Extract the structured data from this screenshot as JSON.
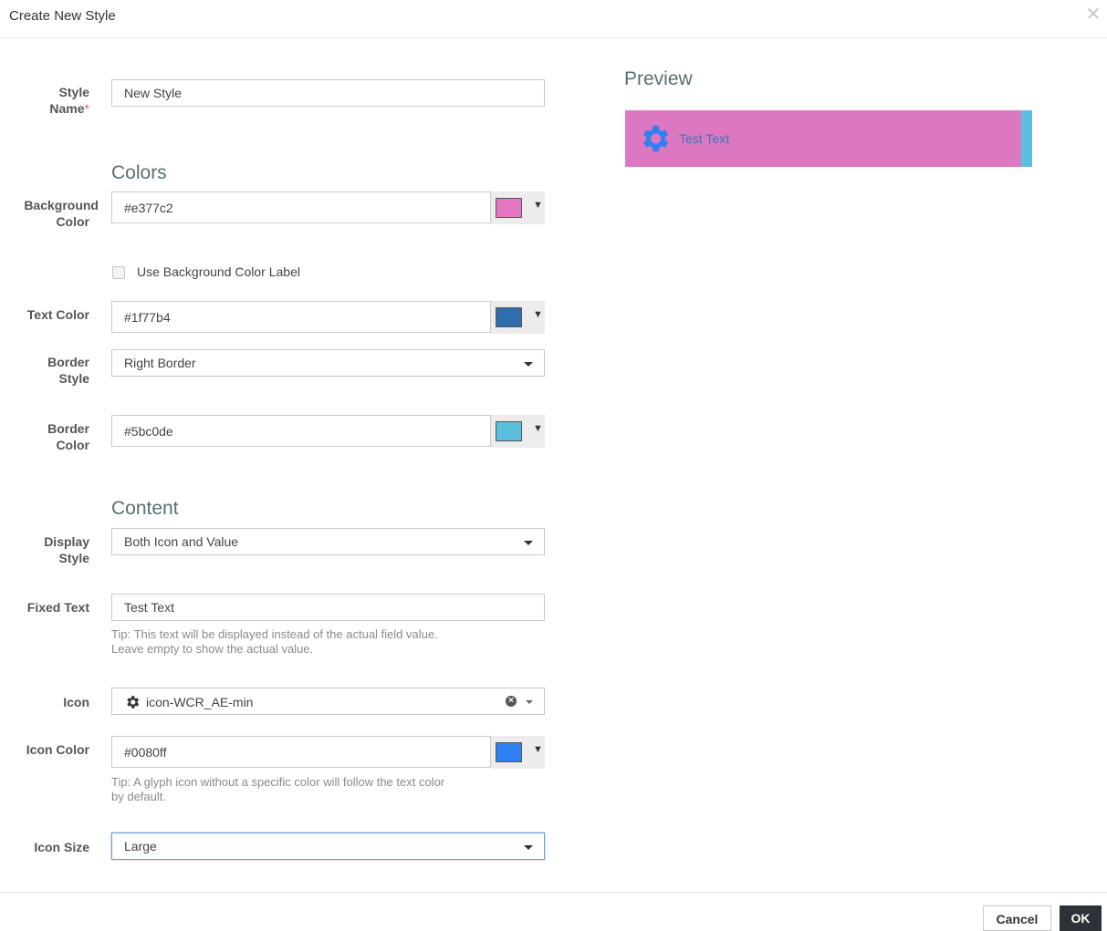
{
  "dialog": {
    "title": "Create New Style",
    "close_icon": "close-icon"
  },
  "form": {
    "style_name": {
      "label_line1": "Style",
      "label_line2": "Name",
      "required_mark": "*",
      "value": "New Style"
    },
    "colors_section": "Colors",
    "background_color": {
      "label_line1": "Background",
      "label_line2": "Color",
      "value": "#e377c2",
      "swatch": "#e377c2"
    },
    "use_bg_label": {
      "label": "Use Background Color Label",
      "checked": false
    },
    "text_color": {
      "label": "Text Color",
      "value": "#1f77b4",
      "swatch": "#2f6eaa"
    },
    "border_style": {
      "label_line1": "Border",
      "label_line2": "Style",
      "value": "Right Border"
    },
    "border_color": {
      "label_line1": "Border",
      "label_line2": "Color",
      "value": "#5bc0de",
      "swatch": "#5bc0de"
    },
    "content_section": "Content",
    "display_style": {
      "label_line1": "Display",
      "label_line2": "Style",
      "value": "Both Icon and Value"
    },
    "fixed_text": {
      "label": "Fixed Text",
      "value": "Test Text",
      "tip_line1": "Tip: This text will be displayed instead of the actual field value.",
      "tip_line2": "Leave empty to show the actual value."
    },
    "icon": {
      "label": "Icon",
      "value": "icon-WCR_AE-min",
      "icon_name": "gear-icon"
    },
    "icon_color": {
      "label": "Icon Color",
      "value": "#0080ff",
      "swatch": "#2f80f0",
      "tip_line1": "Tip: A glyph icon without a specific color will follow the text color",
      "tip_line2": "by default."
    },
    "icon_size": {
      "label": "Icon Size",
      "value": "Large"
    }
  },
  "preview": {
    "title": "Preview",
    "text": "Test Text",
    "background": "#dc78c2",
    "border_color": "#5bc0de",
    "text_color": "#3a74b3",
    "icon_color": "#2f80f0",
    "icon_name": "gear-icon"
  },
  "footer": {
    "cancel_label": "Cancel",
    "ok_label": "OK"
  }
}
